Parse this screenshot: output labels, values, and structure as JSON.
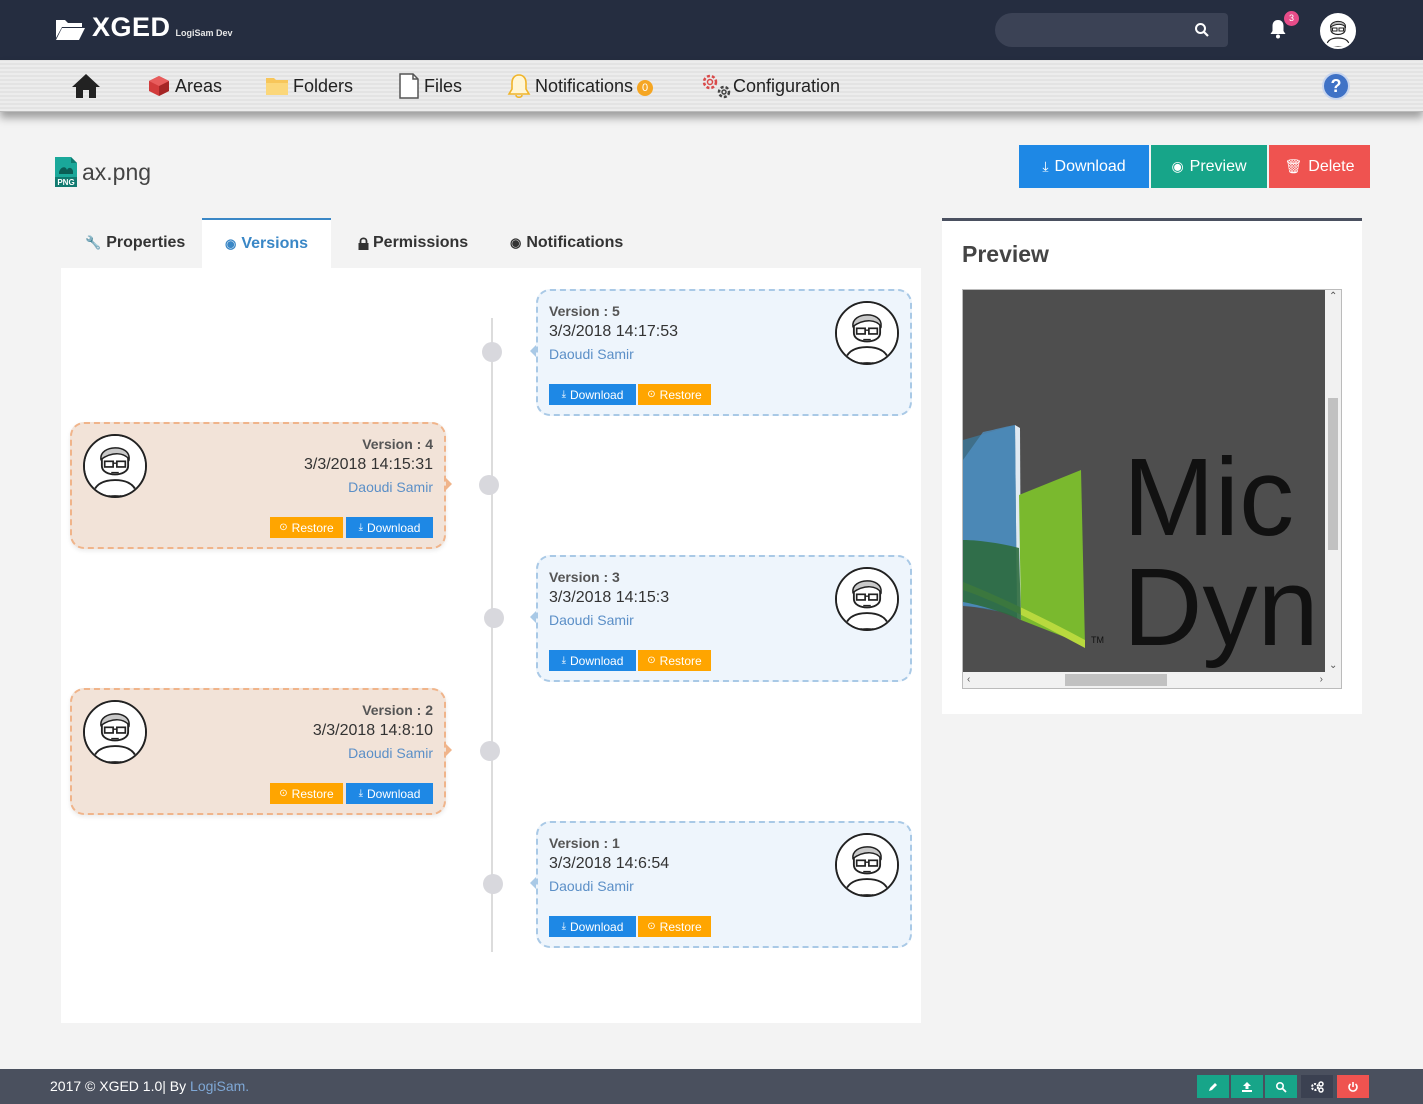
{
  "header": {
    "brand": "XGED",
    "brand_sub": "LogiSam Dev",
    "search_placeholder": "",
    "notification_count": "3"
  },
  "nav": {
    "areas": "Areas",
    "folders": "Folders",
    "files": "Files",
    "notifications": "Notifications",
    "notifications_badge": "0",
    "configuration": "Configuration",
    "help": "?"
  },
  "file": {
    "name": "ax.png",
    "type_badge": "PNG"
  },
  "actions": {
    "download": "Download",
    "preview": "Preview",
    "delete": "Delete"
  },
  "tabs": {
    "properties": "Properties",
    "versions": "Versions",
    "permissions": "Permissions",
    "notifications": "Notifications"
  },
  "versions": [
    {
      "label": "Version : 5",
      "date": "3/3/2018 14:17:53",
      "user": "Daoudi Samir",
      "download": "Download",
      "restore": "Restore"
    },
    {
      "label": "Version : 4",
      "date": "3/3/2018 14:15:31",
      "user": "Daoudi Samir",
      "download": "Download",
      "restore": "Restore"
    },
    {
      "label": "Version : 3",
      "date": "3/3/2018 14:15:3",
      "user": "Daoudi Samir",
      "download": "Download",
      "restore": "Restore"
    },
    {
      "label": "Version : 2",
      "date": "3/3/2018 14:8:10",
      "user": "Daoudi Samir",
      "download": "Download",
      "restore": "Restore"
    },
    {
      "label": "Version : 1",
      "date": "3/3/2018 14:6:54",
      "user": "Daoudi Samir",
      "download": "Download",
      "restore": "Restore"
    }
  ],
  "preview": {
    "title": "Preview",
    "image_text_line1": "Mic",
    "image_text_line2": "Dyn",
    "image_tm": "TM"
  },
  "footer": {
    "text": "2017 © XGED 1.0| By ",
    "link": "LogiSam."
  },
  "colors": {
    "topbar": "#252d40",
    "blue": "#1e88e5",
    "green": "#17a589",
    "red": "#ef5350",
    "orange": "#ffa500",
    "link": "#5b8fc7"
  }
}
